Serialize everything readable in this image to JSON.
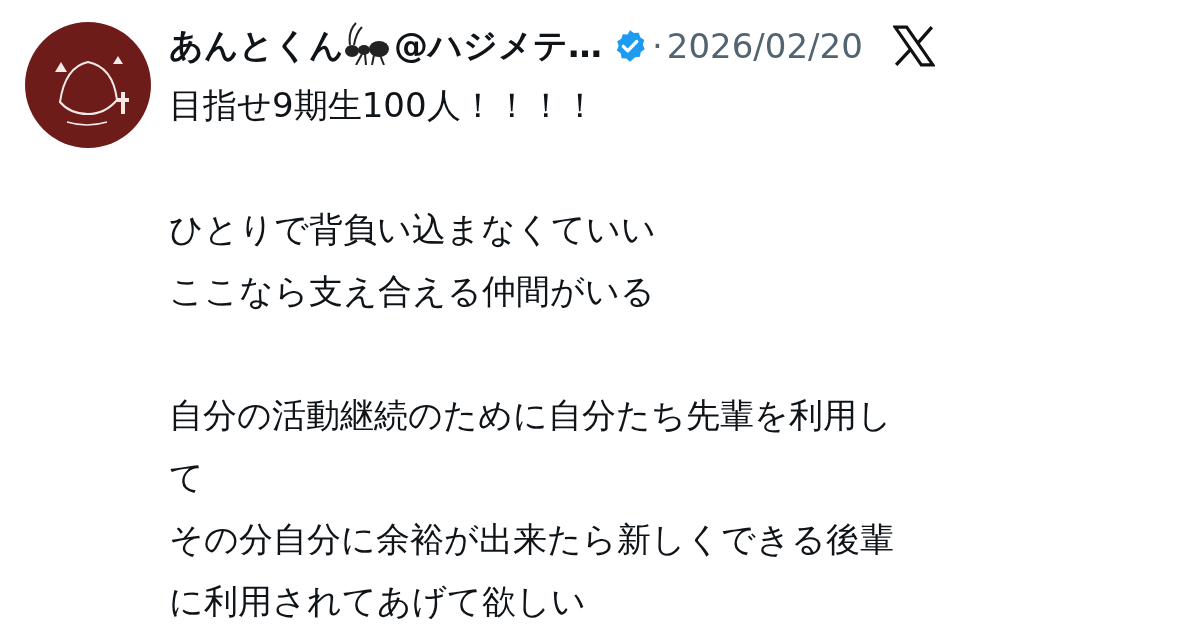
{
  "post": {
    "author": {
      "name": "あんとくん",
      "handle": "@ハジメテ…",
      "verified": true
    },
    "separator": "·",
    "date": "2026/02/20",
    "paragraphs": [
      [
        "目指せ9期生100人！！！！"
      ],
      [
        "ひとりで背負い込まなくていい",
        "ここなら支え合える仲間がいる"
      ],
      [
        "自分の活動継続のために自分たち先輩を利用し",
        "て",
        "その分自分に余裕が出来たら新しくできる後輩",
        "に利用されてあげて欲しい"
      ]
    ]
  }
}
